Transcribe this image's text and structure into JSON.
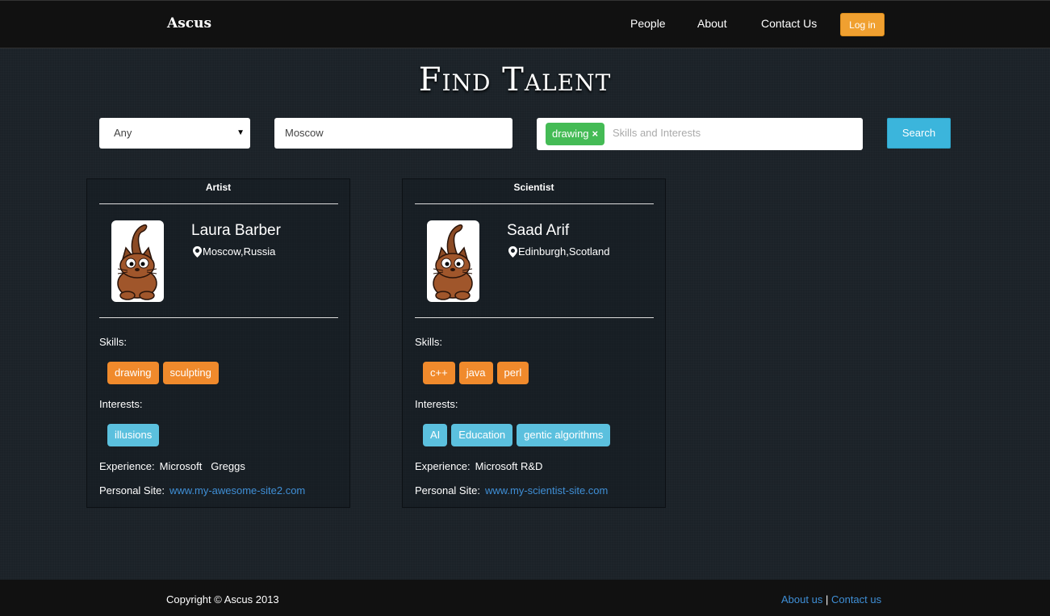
{
  "nav": {
    "brand": "Ascus",
    "links": [
      "People",
      "About",
      "Contact Us"
    ],
    "login_label": "Log in"
  },
  "page_title": "Find Talent",
  "search": {
    "role_selected": "Any",
    "location_value": "Moscow",
    "tag": "drawing",
    "tag_remove": "×",
    "tags_placeholder": "Skills and Interests",
    "button_label": "Search"
  },
  "cards": [
    {
      "role": "Artist",
      "name": "Laura Barber",
      "location": "Moscow,Russia",
      "skills_label": "Skills:",
      "skills": [
        "drawing",
        "sculpting"
      ],
      "interests_label": "Interests:",
      "interests": [
        "illusions"
      ],
      "experience_label": "Experience:",
      "experience": "Microsoft   Greggs",
      "site_label": "Personal Site:",
      "site": "www.my-awesome-site2.com"
    },
    {
      "role": "Scientist",
      "name": "Saad Arif",
      "location": "Edinburgh,Scotland",
      "skills_label": "Skills:",
      "skills": [
        "c++",
        "java",
        "perl"
      ],
      "interests_label": "Interests:",
      "interests": [
        "AI",
        "Education",
        "gentic algorithms"
      ],
      "experience_label": "Experience:",
      "experience": "Microsoft R&D",
      "site_label": "Personal Site:",
      "site": "www.my-scientist-site.com"
    }
  ],
  "footer": {
    "copyright": "Copyright © Ascus 2013",
    "about_link": "About us",
    "separator": "|",
    "contact_link": "Contact us"
  },
  "colors": {
    "skill_chip": "#f08a2c",
    "interest_chip": "#5bc0de",
    "tag_chip": "#44bb55",
    "login_button": "#f0a030",
    "search_button": "#3bb5dc",
    "link": "#3f8fd6"
  },
  "icons": {
    "location": "map-marker-icon",
    "avatar": "cartoon-cat-avatar",
    "select_caret": "caret-down-icon"
  }
}
